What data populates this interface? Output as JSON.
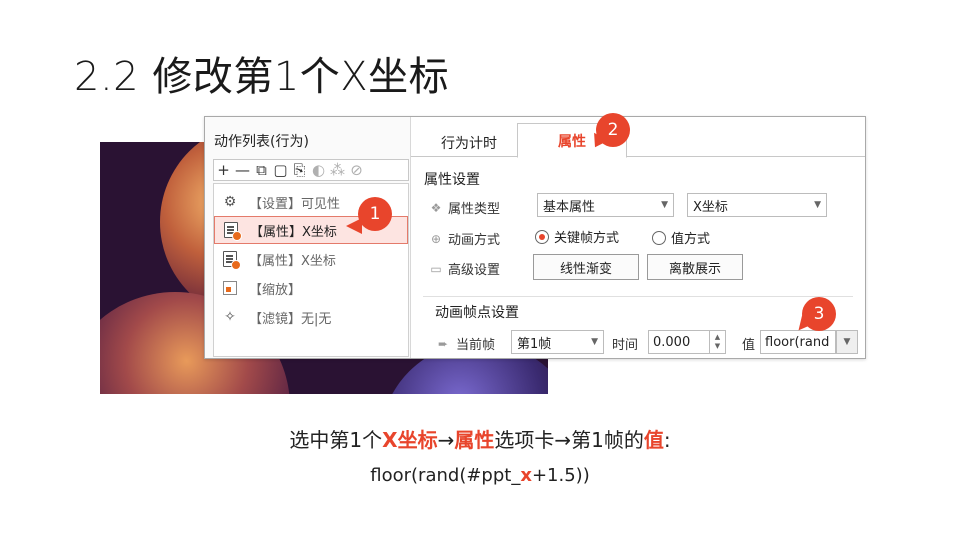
{
  "slide": {
    "title": "2.2 修改第1个X坐标"
  },
  "left_pane": {
    "title": "动作列表(行为)",
    "toolbar": [
      {
        "icon": "plus-icon",
        "glyph": "+"
      },
      {
        "icon": "minus-icon",
        "glyph": "—"
      },
      {
        "icon": "copy-icon",
        "glyph": "⧉"
      },
      {
        "icon": "cut-icon",
        "glyph": "▢"
      },
      {
        "icon": "paste-icon",
        "glyph": "📋"
      },
      {
        "icon": "merge-icon",
        "glyph": "◐"
      },
      {
        "icon": "group-icon",
        "glyph": "⁂"
      },
      {
        "icon": "disable-icon",
        "glyph": "⊘"
      }
    ],
    "actions": [
      {
        "icon": "gear-icon",
        "label": "【设置】可见性",
        "selected": false
      },
      {
        "icon": "property-doc-icon",
        "label": "【属性】X坐标",
        "selected": true
      },
      {
        "icon": "property-doc-icon",
        "label": "【属性】X坐标",
        "selected": false
      },
      {
        "icon": "scale-icon",
        "label": "【缩放】",
        "selected": false
      },
      {
        "icon": "magic-wand-icon",
        "label": "【滤镜】无|无",
        "selected": false
      }
    ]
  },
  "tabs": [
    {
      "label": "行为计时",
      "active": false
    },
    {
      "label": "属性",
      "active": true
    }
  ],
  "props": {
    "section1_title": "属性设置",
    "type_label": "属性类型",
    "type_value": "基本属性",
    "attr_value": "X坐标",
    "anim_label": "动画方式",
    "anim_option1": "关键帧方式",
    "anim_option2": "值方式",
    "anim_selected": "关键帧方式",
    "advanced_label": "高级设置",
    "btn_linear": "线性渐变",
    "btn_discrete": "离散展示",
    "section2_title": "动画帧点设置",
    "frame_label": "当前帧",
    "frame_value": "第1帧",
    "time_label": "时间",
    "time_value": "0.000",
    "value_label": "值",
    "value_value": "floor(rand"
  },
  "badges": [
    "1",
    "2",
    "3"
  ],
  "caption": {
    "part1": "选中第1个",
    "part2": "X坐标",
    "part3": "→",
    "part4": "属性",
    "part5": "选项卡→第1帧的",
    "part6": "值",
    "part7": ":"
  },
  "formula": {
    "part1": "floor(rand(#ppt_",
    "part2": "x",
    "part3": "+1.5))"
  },
  "colors": {
    "accent": "#e8452c",
    "selection_bg": "#fde4e1"
  }
}
